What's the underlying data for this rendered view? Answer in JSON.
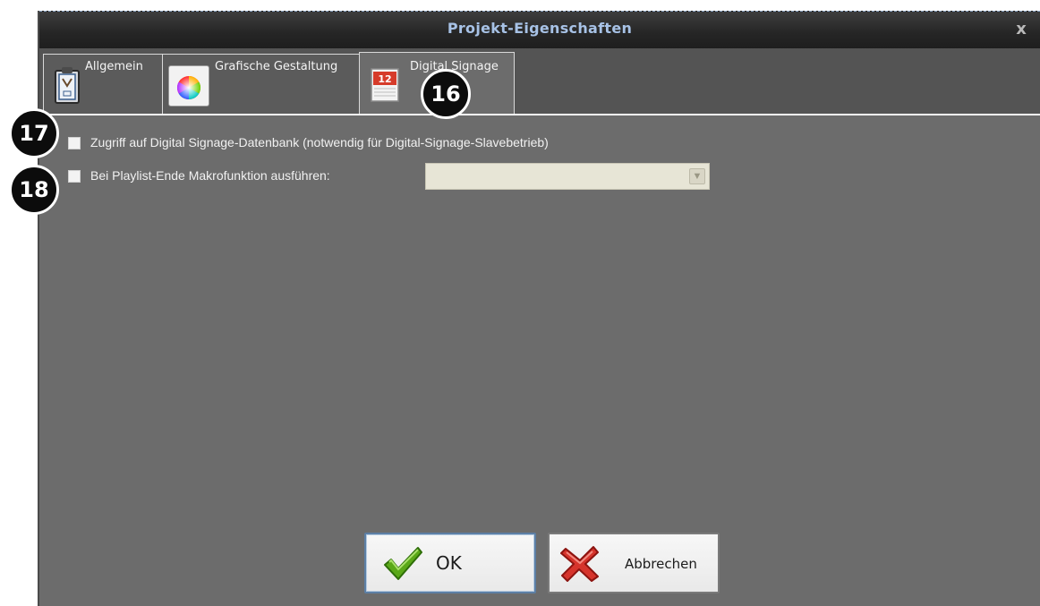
{
  "window": {
    "title": "Projekt-Eigenschaften",
    "close_glyph": "x"
  },
  "tabs": [
    {
      "label": "Allgemein",
      "icon": "clipboard-icon"
    },
    {
      "label": "Grafische Gestaltung",
      "icon": "color-wheel-icon"
    },
    {
      "label": "Digital Signage",
      "icon": "calendar-icon",
      "active": true
    }
  ],
  "options": {
    "db_access_label": "Zugriff auf Digital Signage-Datenbank (notwendig für Digital-Signage-Slavebetrieb)",
    "db_access_checked": false,
    "playlist_macro_label": "Bei Playlist-Ende Makrofunktion ausführen:",
    "playlist_macro_checked": false,
    "playlist_macro_value": ""
  },
  "buttons": {
    "ok_label": "OK",
    "cancel_label": "Abbrechen"
  },
  "markers": [
    "16",
    "17",
    "18"
  ],
  "colors": {
    "title": "#a7c2e6",
    "panel": "#6c6c6c",
    "marker": "#0c0c0c"
  }
}
